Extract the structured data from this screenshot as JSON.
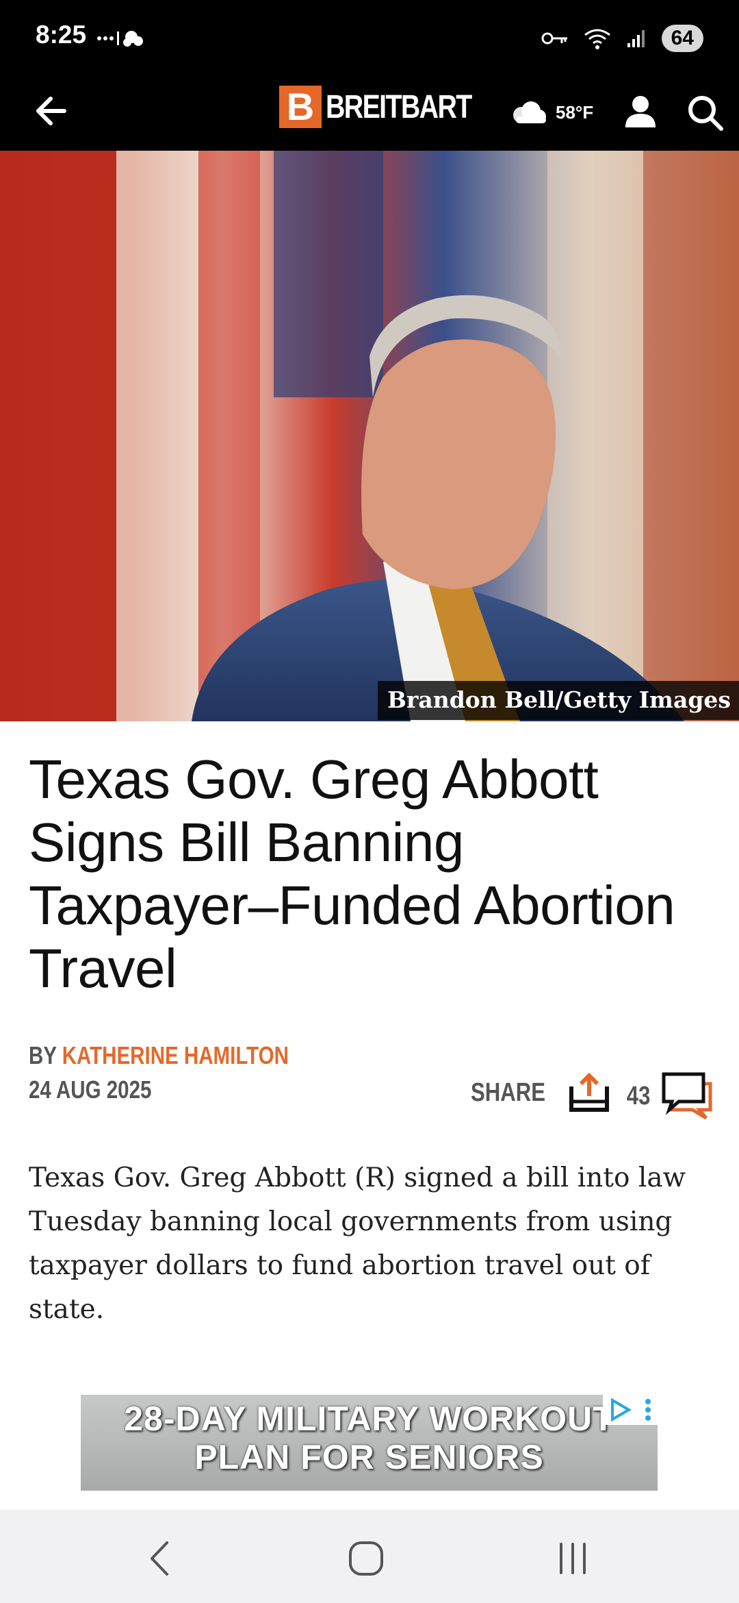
{
  "status_bar": {
    "time": "8:25",
    "battery": "64"
  },
  "header": {
    "brand_mark": "B",
    "brand_name": "BREITBART",
    "weather_temp": "58°F"
  },
  "hero": {
    "photo_credit": "Brandon Bell/Getty Images"
  },
  "article": {
    "headline": "Texas Gov. Greg Abbott Signs Bill Banning Taxpayer–Funded Abortion Travel",
    "byline_prefix": "BY ",
    "author": "KATHERINE HAMILTON",
    "date": "24 AUG 2025",
    "share_label": "SHARE",
    "comment_count": "43",
    "body": "Texas Gov. Greg Abbott (R) signed a bill into law Tuesday banning local governments from using taxpayer dollars to fund abortion travel out of state."
  },
  "ad": {
    "line1": "28-DAY MILITARY WORKOUT",
    "line2": "PLAN FOR SENIORS"
  },
  "colors": {
    "brand": "#e5682a",
    "header_bg": "#000000"
  }
}
